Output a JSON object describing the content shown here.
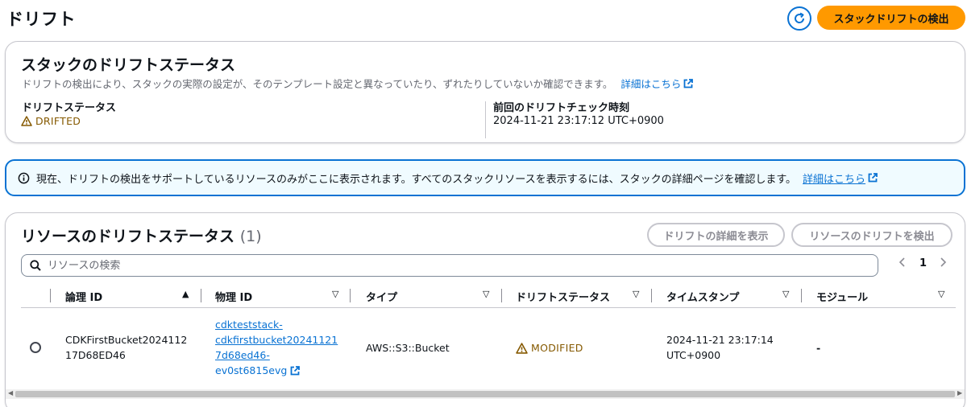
{
  "page": {
    "title": "ドリフト",
    "detect_button": "スタックドリフトの検出"
  },
  "stack_status": {
    "heading": "スタックのドリフトステータス",
    "description": "ドリフトの検出により、スタックの実際の設定が、そのテンプレート設定と異なっていたり、ずれたりしていないか確認できます。",
    "link": "詳細はこちら",
    "drift_label": "ドリフトステータス",
    "drift_value": "DRIFTED",
    "last_check_label": "前回のドリフトチェック時刻",
    "last_check_value": "2024-11-21 23:17:12 UTC+0900"
  },
  "info": {
    "message": "現在、ドリフトの検出をサポートしているリソースのみがここに表示されます。すべてのスタックリソースを表示するには、スタックの詳細ページを確認します。",
    "link": "詳細はこちら"
  },
  "resources": {
    "heading": "リソースのドリフトステータス",
    "count": "(1)",
    "view_details_button": "ドリフトの詳細を表示",
    "detect_resource_button": "リソースのドリフトを検出",
    "search_placeholder": "リソースの検索",
    "page_number": "1",
    "columns": [
      "論理 ID",
      "物理 ID",
      "タイプ",
      "ドリフトステータス",
      "タイムスタンプ",
      "モジュール"
    ],
    "rows": [
      {
        "logical_id_1": "CDKFirstBucket2024112",
        "logical_id_2": "17D68ED46",
        "physical_id_1": "cdkteststack-",
        "physical_id_2": "cdkfirstbucket20241121",
        "physical_id_3": "7d68ed46-",
        "physical_id_4": "ev0st6815evg",
        "type": "AWS::S3::Bucket",
        "drift_status": "MODIFIED",
        "timestamp_1": "2024-11-21 23:17:14",
        "timestamp_2": "UTC+0900",
        "module": "-"
      }
    ]
  },
  "colors": {
    "primary": "#ff9900",
    "link": "#0972d3",
    "warning": "#855900",
    "info_bg": "#f0fbff"
  }
}
